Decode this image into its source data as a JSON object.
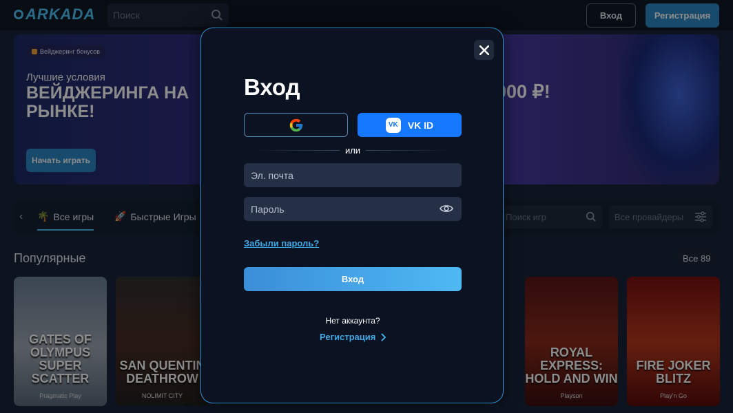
{
  "header": {
    "logo": "ARKADA",
    "search_placeholder": "Поиск",
    "login_label": "Вход",
    "register_label": "Регистрация"
  },
  "banner": {
    "badge": "Вейджеринг бонусов",
    "subtitle": "Лучшие условия",
    "title": "ВЕЙДЖЕРИНГА НА РЫНКЕ!",
    "cta": "Начать играть",
    "amount_fragment": "000 ₽!"
  },
  "tabs": {
    "items": [
      "Все игры",
      "Быстрые Игры"
    ],
    "game_search_placeholder": "Поиск игр",
    "providers_label": "Все провайдеры"
  },
  "popular": {
    "title": "Популярные",
    "see_all": "Все 89",
    "cards": [
      {
        "name": "GATES OF OLYMPUS SUPER SCATTER",
        "provider": "Pragmatic Play"
      },
      {
        "name": "SAN QUENTIN DEATHROW",
        "provider": "NOLIMIT CITY"
      },
      {
        "name": "ROYAL EXPRESS: HOLD AND WIN",
        "provider": "Playson"
      },
      {
        "name": "FIRE JOKER BLITZ",
        "provider": "Play'n Go"
      }
    ]
  },
  "modal": {
    "title": "Вход",
    "vk_label": "VK ID",
    "vk_logo": "VK",
    "divider_text": "или",
    "email_placeholder": "Эл. почта",
    "password_placeholder": "Пароль",
    "forgot_label": "Забыли пароль?",
    "submit_label": "Вход",
    "no_account_text": "Нет аккаунта?",
    "register_label": "Регистрация"
  },
  "colors": {
    "accent": "#3fa9e6",
    "modal_border": "#2f8fca",
    "vk_blue": "#1677ff",
    "submit_gradient_start": "#3b8ed8",
    "submit_gradient_end": "#4fb9f4"
  }
}
